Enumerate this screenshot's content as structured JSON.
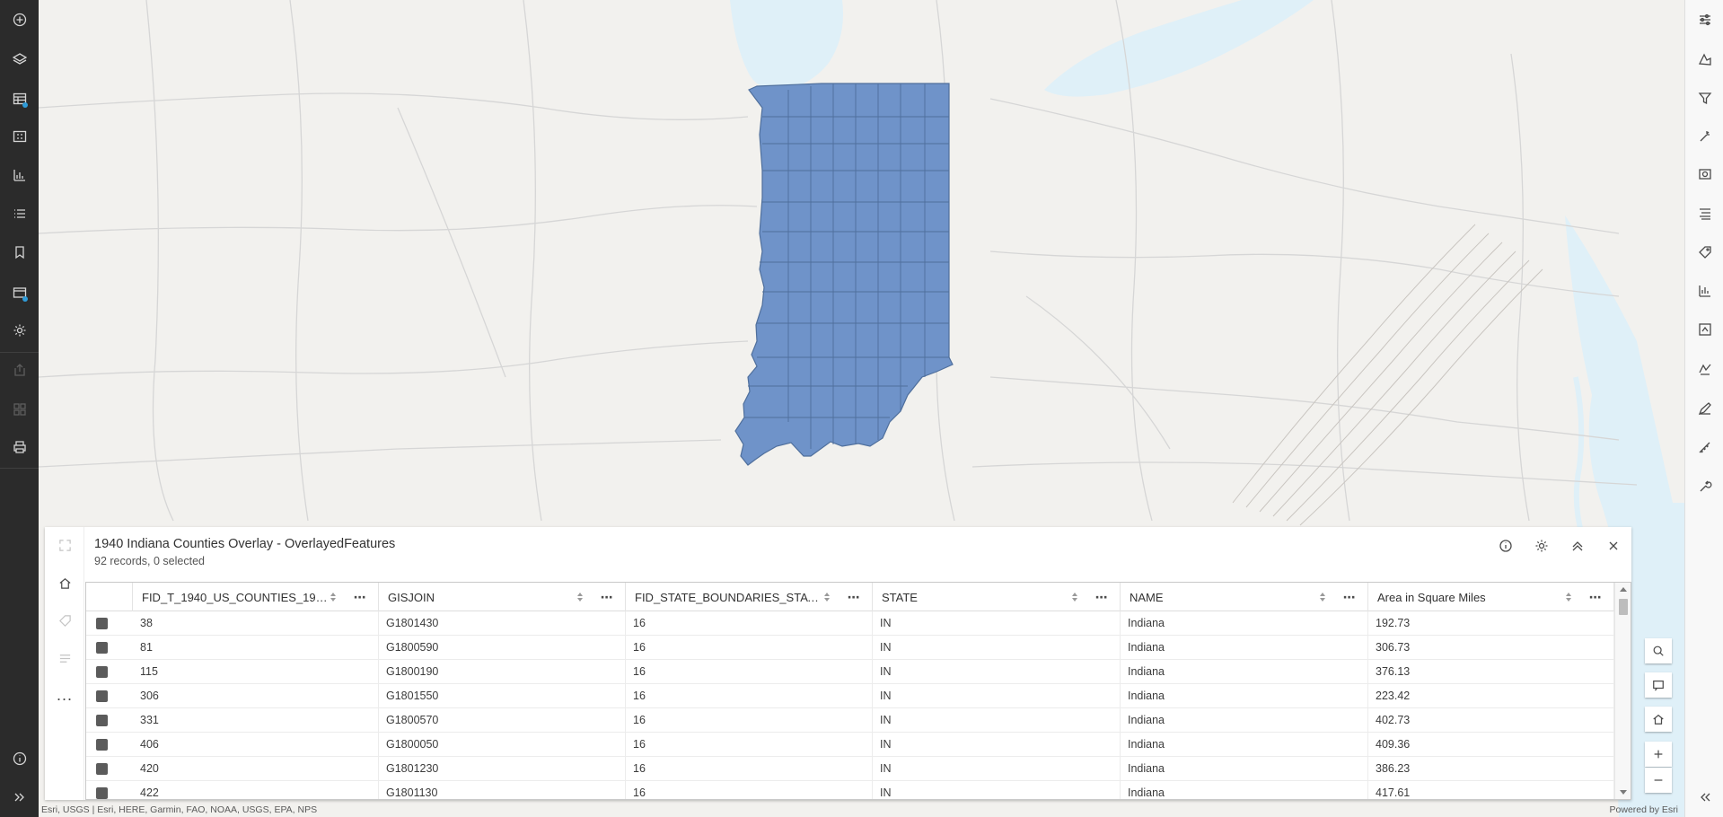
{
  "left_toolbar": {
    "tools": [
      {
        "name": "add-icon",
        "disabled": false,
        "dot": false
      },
      {
        "name": "layers-icon",
        "disabled": false,
        "dot": false
      },
      {
        "name": "tables-icon",
        "disabled": false,
        "dot": true
      },
      {
        "name": "widgets-icon",
        "disabled": false,
        "dot": false
      },
      {
        "name": "charts-icon",
        "disabled": false,
        "dot": false
      },
      {
        "name": "legend-icon",
        "disabled": false,
        "dot": false
      },
      {
        "name": "bookmarks-icon",
        "disabled": false,
        "dot": false
      },
      {
        "name": "map-properties-icon",
        "disabled": false,
        "dot": true
      },
      {
        "name": "settings-icon",
        "disabled": false,
        "dot": false
      },
      {
        "name": "share-icon",
        "disabled": true,
        "dot": false
      },
      {
        "name": "create-app-icon",
        "disabled": true,
        "dot": false
      },
      {
        "name": "print-icon",
        "disabled": false,
        "dot": false
      }
    ],
    "bottom": [
      {
        "name": "info-icon"
      },
      {
        "name": "expand-icon"
      }
    ]
  },
  "right_toolbar": {
    "tools": [
      {
        "name": "properties-icon"
      },
      {
        "name": "styles-icon"
      },
      {
        "name": "filter-icon"
      },
      {
        "name": "effects-icon"
      },
      {
        "name": "pop-ups-icon"
      },
      {
        "name": "fields-icon"
      },
      {
        "name": "labels-icon"
      },
      {
        "name": "analysis-icon"
      },
      {
        "name": "configure-icon"
      },
      {
        "name": "sketch-icon"
      },
      {
        "name": "edit-icon"
      },
      {
        "name": "measure-icon"
      },
      {
        "name": "tools-icon"
      }
    ],
    "collapse": {
      "name": "collapse-icon"
    }
  },
  "map": {
    "basemap_bg": "#f2f1ee",
    "water_color": "#dff0f8",
    "road_color": "#d4d4d4",
    "feature_fill": "#6f93c9",
    "feature_stroke": "#4f6f9c"
  },
  "table_panel": {
    "title": "1940 Indiana Counties Overlay - OverlayedFeatures",
    "subtitle": "92 records, 0 selected",
    "actions": [
      {
        "name": "info-icon"
      },
      {
        "name": "options-icon"
      },
      {
        "name": "collapse-up-icon"
      },
      {
        "name": "close-icon"
      }
    ],
    "side_tools": [
      {
        "name": "zoom-to-icon",
        "disabled": true
      },
      {
        "name": "home-icon",
        "disabled": false
      },
      {
        "name": "tag-icon",
        "disabled": true
      },
      {
        "name": "filter-selection-icon",
        "disabled": true
      }
    ],
    "more_label": "...",
    "columns": [
      "FID_T_1940_US_COUNTIES_1940_...",
      "GISJOIN",
      "FID_STATE_BOUNDARIES_STATE_...",
      "STATE",
      "NAME",
      "Area in Square Miles"
    ],
    "rows": [
      [
        "38",
        "G1801430",
        "16",
        "IN",
        "Indiana",
        "192.73"
      ],
      [
        "81",
        "G1800590",
        "16",
        "IN",
        "Indiana",
        "306.73"
      ],
      [
        "115",
        "G1800190",
        "16",
        "IN",
        "Indiana",
        "376.13"
      ],
      [
        "306",
        "G1801550",
        "16",
        "IN",
        "Indiana",
        "223.42"
      ],
      [
        "331",
        "G1800570",
        "16",
        "IN",
        "Indiana",
        "402.73"
      ],
      [
        "406",
        "G1800050",
        "16",
        "IN",
        "Indiana",
        "409.36"
      ],
      [
        "420",
        "G1801230",
        "16",
        "IN",
        "Indiana",
        "386.23"
      ],
      [
        "422",
        "G1801130",
        "16",
        "IN",
        "Indiana",
        "417.61"
      ]
    ]
  },
  "map_widgets": [
    {
      "name": "search-icon"
    },
    {
      "name": "popup-dock-icon"
    },
    {
      "name": "home-icon"
    },
    {
      "name": "zoom-in-icon"
    },
    {
      "name": "zoom-out-icon"
    }
  ],
  "attribution": "Esri, USGS | Esri, HERE, Garmin, FAO, NOAA, USGS, EPA, NPS",
  "powered_by": "Powered by Esri"
}
